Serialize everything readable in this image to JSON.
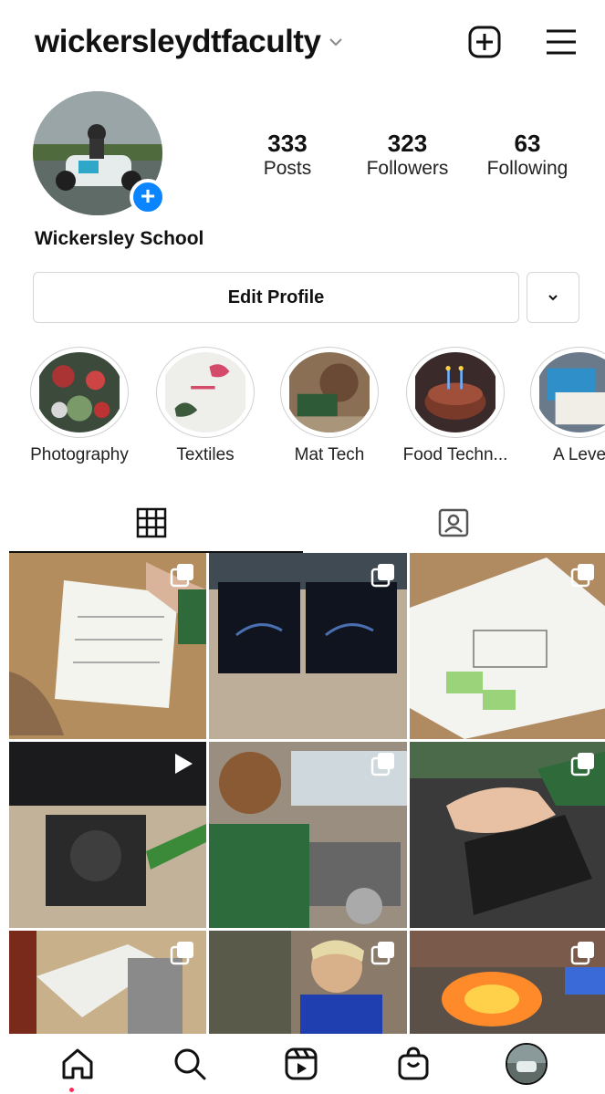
{
  "header": {
    "username": "wickersleydtfaculty",
    "icons": [
      "chevron-down-icon",
      "new-post-icon",
      "menu-icon"
    ]
  },
  "profile": {
    "display_name": "Wickersley School",
    "stats": [
      {
        "value": "333",
        "label": "Posts"
      },
      {
        "value": "323",
        "label": "Followers"
      },
      {
        "value": "63",
        "label": "Following"
      }
    ],
    "add_badge": "+",
    "edit_label": "Edit Profile"
  },
  "highlights": [
    {
      "label": "Photography"
    },
    {
      "label": "Textiles"
    },
    {
      "label": "Mat Tech"
    },
    {
      "label": "Food Techn..."
    },
    {
      "label": "A Leve"
    }
  ],
  "tabs": [
    "grid-icon",
    "tagged-icon"
  ],
  "grid": {
    "tiles": [
      {
        "badge": "multiple-posts-icon"
      },
      {
        "badge": "multiple-posts-icon"
      },
      {
        "badge": "multiple-posts-icon"
      },
      {
        "badge": "reel-icon"
      },
      {
        "badge": "multiple-posts-icon"
      },
      {
        "badge": "multiple-posts-icon"
      },
      {
        "badge": "multiple-posts-icon"
      },
      {
        "badge": "multiple-posts-icon"
      },
      {
        "badge": "multiple-posts-icon"
      }
    ]
  },
  "bottom_nav": [
    "home-icon",
    "search-icon",
    "reels-icon",
    "shop-icon",
    "profile-avatar"
  ],
  "colors": {
    "accent": "#0a84ff",
    "notification": "#ff2d55"
  }
}
